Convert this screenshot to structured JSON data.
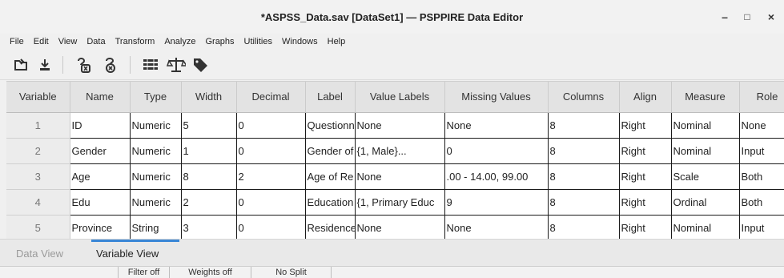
{
  "window": {
    "title": "*ASPSS_Data.sav [DataSet1] — PSPPIRE Data Editor",
    "minimize": "–",
    "maximize": "□",
    "close": "×"
  },
  "menu": [
    "File",
    "Edit",
    "View",
    "Data",
    "Transform",
    "Analyze",
    "Graphs",
    "Utilities",
    "Windows",
    "Help"
  ],
  "toolbar": {
    "icons": [
      "open-file-icon",
      "save-icon",
      "goto-case-icon",
      "goto-variable-icon",
      "insert-cases-icon",
      "weight-cases-icon",
      "value-labels-icon"
    ]
  },
  "grid": {
    "headers": [
      "Variable",
      "Name",
      "Type",
      "Width",
      "Decimal",
      "Label",
      "Value Labels",
      "Missing Values",
      "Columns",
      "Align",
      "Measure",
      "Role"
    ],
    "rows": [
      [
        "1",
        "ID",
        "Numeric",
        "5",
        "0",
        "Questionnaire",
        "None",
        "None",
        "8",
        "Right",
        "Nominal",
        "None"
      ],
      [
        "2",
        "Gender",
        "Numeric",
        "1",
        "0",
        "Gender of",
        "{1, Male}...",
        "0",
        "8",
        "Right",
        "Nominal",
        "Input"
      ],
      [
        "3",
        "Age",
        "Numeric",
        "8",
        "2",
        "Age of Re",
        "None",
        ".00 - 14.00, 99.00",
        "8",
        "Right",
        "Scale",
        "Both"
      ],
      [
        "4",
        "Edu",
        "Numeric",
        "2",
        "0",
        "Education",
        "{1, Primary Educ",
        "9",
        "8",
        "Right",
        "Ordinal",
        "Both"
      ],
      [
        "5",
        "Province",
        "String",
        "3",
        "0",
        "Residence",
        "None",
        "None",
        "8",
        "Right",
        "Nominal",
        "Input"
      ]
    ]
  },
  "tabs": {
    "data_view": "Data View",
    "variable_view": "Variable View",
    "active": "Variable View"
  },
  "status": {
    "filter": "Filter off",
    "weights": "Weights off",
    "split": "No Split"
  },
  "colors": {
    "active_tab_indicator": "#3a87d6",
    "header_bg": "#e3e3e3"
  }
}
